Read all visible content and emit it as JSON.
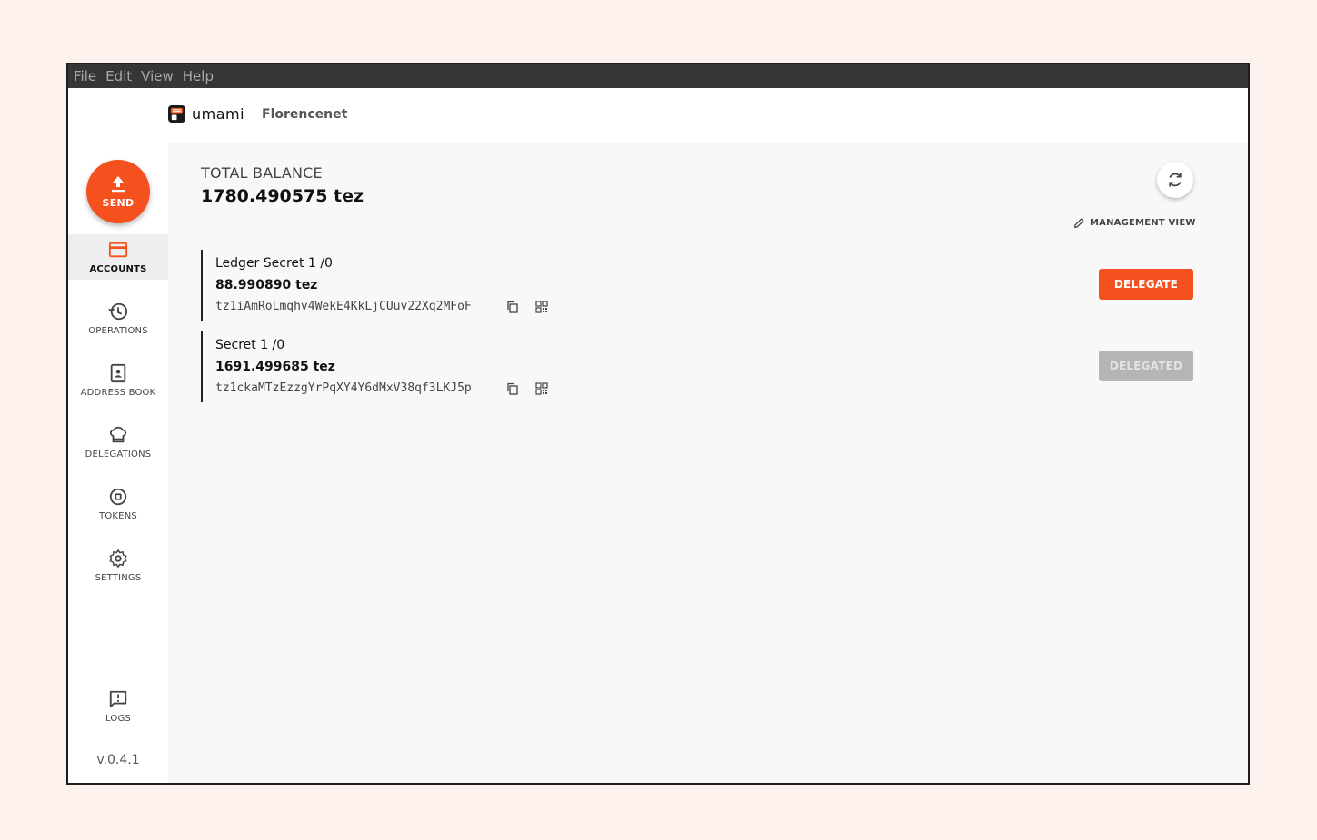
{
  "menu": {
    "items": [
      "File",
      "Edit",
      "View",
      "Help"
    ]
  },
  "header": {
    "logo_text": "umami",
    "network": "Florencenet"
  },
  "sidebar": {
    "send_label": "SEND",
    "items": [
      {
        "label": "ACCOUNTS",
        "icon": "credit-card-icon",
        "active": true
      },
      {
        "label": "OPERATIONS",
        "icon": "history-icon",
        "active": false
      },
      {
        "label": "ADDRESS BOOK",
        "icon": "contact-book-icon",
        "active": false
      },
      {
        "label": "DELEGATIONS",
        "icon": "chef-hat-icon",
        "active": false
      },
      {
        "label": "TOKENS",
        "icon": "token-icon",
        "active": false
      },
      {
        "label": "SETTINGS",
        "icon": "gear-icon",
        "active": false
      }
    ],
    "logs_label": "LOGS",
    "version": "v.0.4.1"
  },
  "main": {
    "total_label": "TOTAL BALANCE",
    "total_value": "1780.490575 tez",
    "management_view_label": "MANAGEMENT VIEW",
    "accounts": [
      {
        "name": "Ledger Secret 1 /0",
        "balance": "88.990890 tez",
        "address": "tz1iAmRoLmqhv4WekE4KkLjCUuv22Xq2MFoF",
        "action_label": "DELEGATE",
        "action_state": "enabled"
      },
      {
        "name": "Secret 1 /0",
        "balance": "1691.499685 tez",
        "address": "tz1ckaMTzEzzgYrPqXY4Y6dMxV38qf3LKJ5p",
        "action_label": "DELEGATED",
        "action_state": "disabled"
      }
    ]
  },
  "colors": {
    "accent": "#f4511e",
    "menubar": "#363636",
    "background": "#fcf1ec",
    "disabled_button": "#b5b5b5"
  }
}
